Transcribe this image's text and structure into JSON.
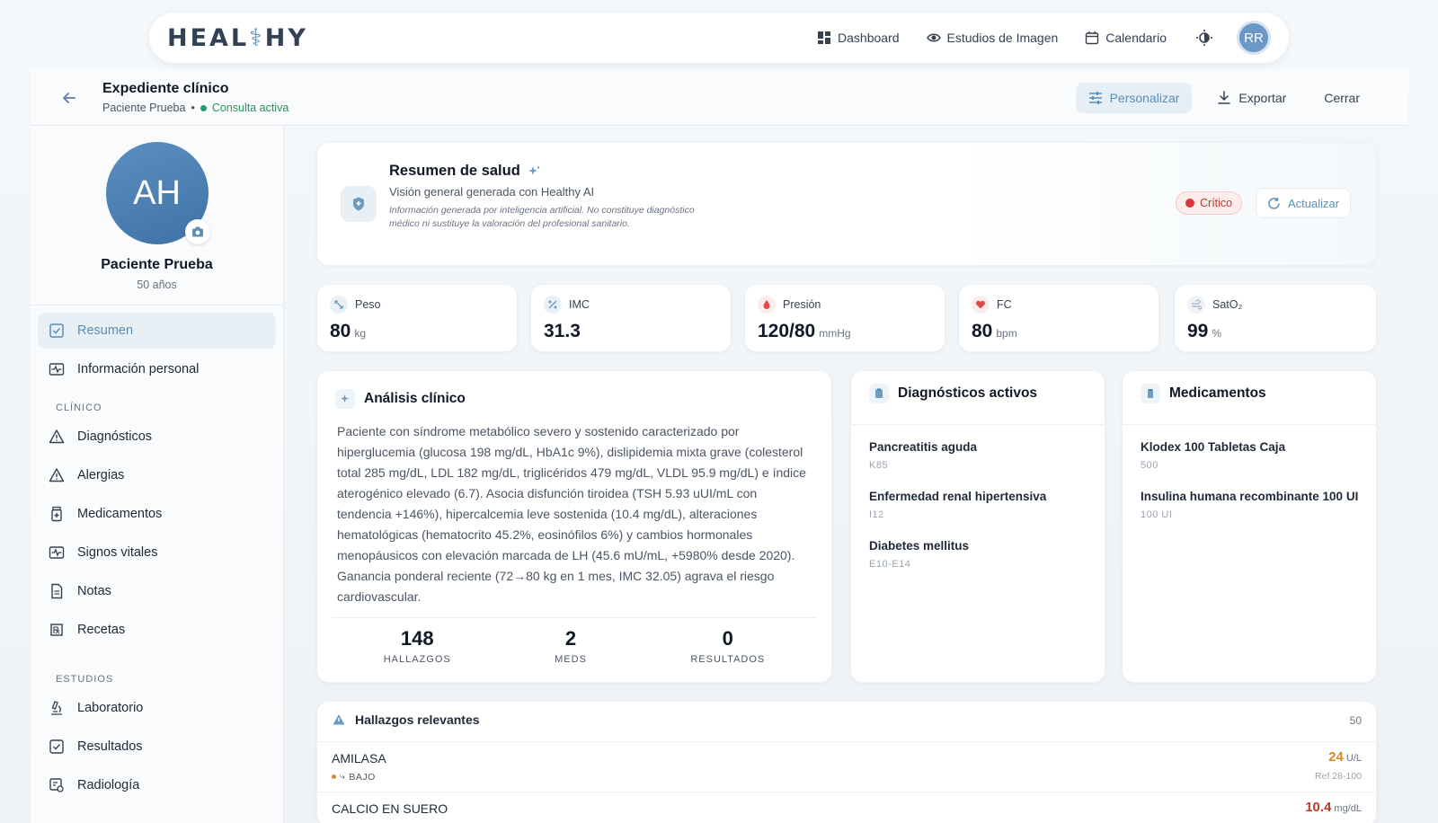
{
  "nav": {
    "logo_left": "HEAL",
    "logo_right": "HY",
    "links": [
      {
        "label": "Dashboard",
        "icon": "grid-icon"
      },
      {
        "label": "Estudios de Imagen",
        "icon": "eye-icon"
      },
      {
        "label": "Calendario",
        "icon": "calendar-icon"
      }
    ],
    "user_initials": "RR"
  },
  "header": {
    "title": "Expediente clínico",
    "patient": "Paciente Prueba",
    "separator": "•",
    "status": "Consulta activa",
    "personalizar": "Personalizar",
    "exportar": "Exportar",
    "cerrar": "Cerrar"
  },
  "sidebar": {
    "initials": "AH",
    "name": "Paciente Prueba",
    "age": "50 años",
    "top_items": [
      {
        "label": "Resumen",
        "active": true
      },
      {
        "label": "Información personal"
      }
    ],
    "clinico_title": "CLÍNICO",
    "clinico_items": [
      {
        "label": "Diagnósticos"
      },
      {
        "label": "Alergias"
      },
      {
        "label": "Medicamentos"
      },
      {
        "label": "Signos vitales"
      },
      {
        "label": "Notas"
      },
      {
        "label": "Recetas"
      }
    ],
    "estudios_title": "ESTUDIOS",
    "estudios_items": [
      {
        "label": "Laboratorio"
      },
      {
        "label": "Resultados"
      },
      {
        "label": "Radiología"
      }
    ]
  },
  "summary": {
    "title": "Resumen de salud",
    "subtitle": "Visión general generada con Healthy AI",
    "disclaimer": "Información generada por inteligencia artificial. No constituye diagnóstico médico ni sustituye la valoración del profesional sanitario.",
    "badge": "Crítico",
    "refresh": "Actualizar",
    "accent": "#5b8fb5",
    "critical_color": "#d93838"
  },
  "vitals": [
    {
      "label": "Peso",
      "value": "80",
      "unit": "kg"
    },
    {
      "label": "IMC",
      "value": "31.3",
      "unit": ""
    },
    {
      "label": "Presión",
      "value": "120/80",
      "unit": "mmHg"
    },
    {
      "label": "FC",
      "value": "80",
      "unit": "bpm"
    },
    {
      "label": "SatO₂",
      "value": "99",
      "unit": "%"
    }
  ],
  "analisis": {
    "title": "Análisis clínico",
    "text": "Paciente con síndrome metabólico severo y sostenido caracterizado por hiperglucemia (glucosa 198 mg/dL, HbA1c 9%), dislipidemia mixta grave (colesterol total 285 mg/dL, LDL 182 mg/dL, triglicéridos 479 mg/dL, VLDL 95.9 mg/dL) e índice aterogénico elevado (6.7). Asocia disfunción tiroidea (TSH 5.93 uUI/mL con tendencia +146%), hipercalcemia leve sostenida (10.4 mg/dL), alteraciones hematológicas (hematocrito 45.2%, eosinófilos 6%) y cambios hormonales menopáusicos con elevación marcada de LH (45.6 mU/mL, +5980% desde 2020). Ganancia ponderal reciente (72→80 kg en 1 mes, IMC 32.05) agrava el riesgo cardiovascular.",
    "stats": [
      {
        "n": "148",
        "l": "HALLAZGOS"
      },
      {
        "n": "2",
        "l": "MEDS"
      },
      {
        "n": "0",
        "l": "RESULTADOS"
      }
    ]
  },
  "diagnosticos": {
    "title": "Diagnósticos activos",
    "items": [
      {
        "name": "Pancreatitis aguda",
        "code": "K85"
      },
      {
        "name": "Enfermedad renal hipertensiva",
        "code": "I12"
      },
      {
        "name": "Diabetes mellitus",
        "code": "E10-E14"
      }
    ]
  },
  "medicamentos": {
    "title": "Medicamentos",
    "items": [
      {
        "name": "Klodex 100 Tabletas Caja",
        "code": "500"
      },
      {
        "name": "Insulina humana recombinante 100 UI",
        "code": "100 UI"
      }
    ]
  },
  "hallazgos": {
    "title": "Hallazgos relevantes",
    "count": "50",
    "rows": [
      {
        "name": "AMILASA",
        "flag": "BAJO",
        "value": "24",
        "unit": "U/L",
        "ref": "Ref 28-100",
        "color": "#d98a1f"
      },
      {
        "name": "CALCIO EN SUERO",
        "flag": "",
        "value": "10.4",
        "unit": "mg/dL",
        "ref": "",
        "color": "#c0392b"
      }
    ]
  }
}
